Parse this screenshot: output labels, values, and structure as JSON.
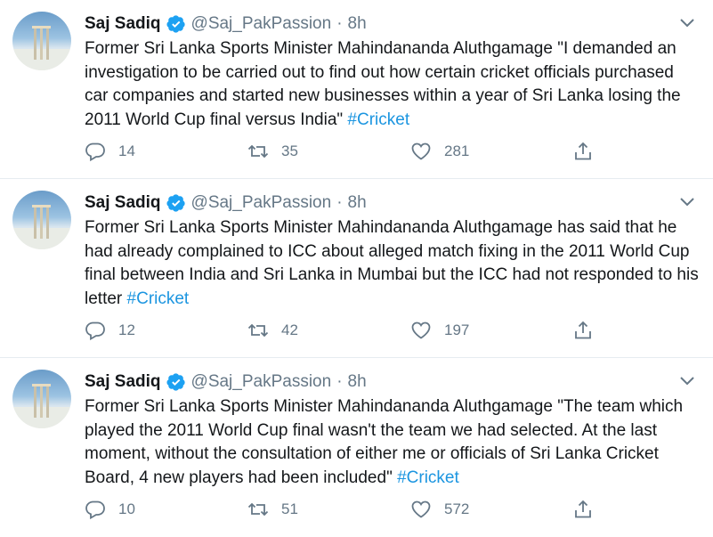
{
  "tweets": [
    {
      "author_name": "Saj Sadiq",
      "handle": "@Saj_PakPassion",
      "separator": "·",
      "time": "8h",
      "text": "Former Sri Lanka Sports Minister Mahindananda Aluthgamage \"I demanded an investigation to be carried out to find out how certain cricket officials purchased car companies and started new businesses within a year of Sri Lanka losing the 2011 World Cup final versus India\" ",
      "hashtag": "#Cricket",
      "replies": "14",
      "retweets": "35",
      "likes": "281"
    },
    {
      "author_name": "Saj Sadiq",
      "handle": "@Saj_PakPassion",
      "separator": "·",
      "time": "8h",
      "text": "Former Sri Lanka Sports Minister Mahindananda Aluthgamage has said that he had already complained to ICC about alleged match fixing in the 2011 World Cup final between India and Sri Lanka in Mumbai but the ICC had not responded to his letter ",
      "hashtag": "#Cricket",
      "replies": "12",
      "retweets": "42",
      "likes": "197"
    },
    {
      "author_name": "Saj Sadiq",
      "handle": "@Saj_PakPassion",
      "separator": "·",
      "time": "8h",
      "text": "Former Sri Lanka Sports Minister Mahindananda Aluthgamage \"The team which played the 2011 World Cup final wasn't the team we had selected. At the last moment, without the consultation of either me or officials of Sri Lanka Cricket Board, 4 new players had been included\" ",
      "hashtag": "#Cricket",
      "replies": "10",
      "retweets": "51",
      "likes": "572"
    }
  ],
  "icons": {
    "verified": "verified-badge-icon",
    "menu": "chevron-down-icon",
    "reply": "reply-icon",
    "retweet": "retweet-icon",
    "like": "heart-icon",
    "share": "share-icon"
  },
  "colors": {
    "text": "#14171a",
    "secondary": "#657786",
    "link": "#1b95e0",
    "verified": "#1da1f2",
    "divider": "#e6ecf0"
  }
}
